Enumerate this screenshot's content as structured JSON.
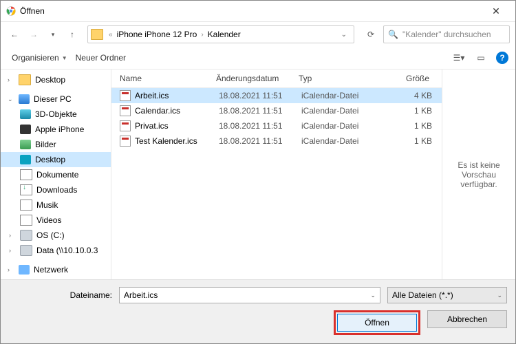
{
  "title": "Öffnen",
  "breadcrumb": {
    "sep_left": "«",
    "parts": [
      "iPhone iPhone 12 Pro",
      "Kalender"
    ]
  },
  "search": {
    "placeholder": "\"Kalender\" durchsuchen"
  },
  "toolbar": {
    "organize": "Organisieren",
    "new_folder": "Neuer Ordner"
  },
  "tree": {
    "desktop_top": "Desktop",
    "this_pc": "Dieser PC",
    "items": [
      {
        "label": "3D-Objekte"
      },
      {
        "label": "Apple iPhone"
      },
      {
        "label": "Bilder"
      },
      {
        "label": "Desktop"
      },
      {
        "label": "Dokumente"
      },
      {
        "label": "Downloads"
      },
      {
        "label": "Musik"
      },
      {
        "label": "Videos"
      },
      {
        "label": "OS (C:)"
      },
      {
        "label": "Data (\\\\10.10.0.3"
      }
    ],
    "network": "Netzwerk"
  },
  "columns": {
    "name": "Name",
    "date": "Änderungsdatum",
    "type": "Typ",
    "size": "Größe"
  },
  "files": [
    {
      "name": "Arbeit.ics",
      "date": "18.08.2021 11:51",
      "type": "iCalendar-Datei",
      "size": "4 KB",
      "selected": true
    },
    {
      "name": "Calendar.ics",
      "date": "18.08.2021 11:51",
      "type": "iCalendar-Datei",
      "size": "1 KB",
      "selected": false
    },
    {
      "name": "Privat.ics",
      "date": "18.08.2021 11:51",
      "type": "iCalendar-Datei",
      "size": "1 KB",
      "selected": false
    },
    {
      "name": "Test Kalender.ics",
      "date": "18.08.2021 11:51",
      "type": "iCalendar-Datei",
      "size": "1 KB",
      "selected": false
    }
  ],
  "preview": {
    "text": "Es ist keine Vorschau verfügbar."
  },
  "bottom": {
    "filename_label": "Dateiname:",
    "filename_value": "Arbeit.ics",
    "filter": "Alle Dateien (*.*)",
    "open": "Öffnen",
    "cancel": "Abbrechen"
  }
}
